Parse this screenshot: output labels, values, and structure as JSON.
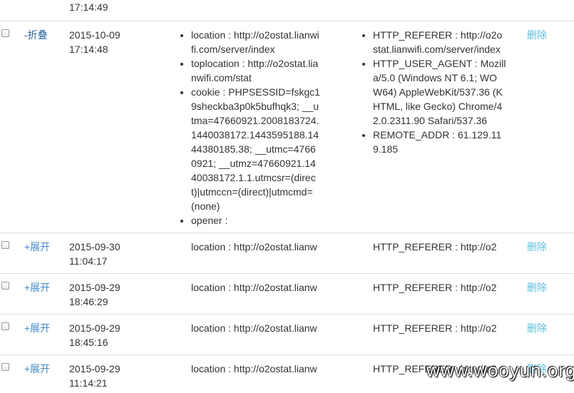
{
  "top_partial": {
    "time": "17:14:49"
  },
  "expanded_row": {
    "toggle": "-折叠",
    "date": "2015-10-09",
    "time": "17:14:48",
    "cookies": [
      "location : http://o2ostat.lianwifi.com/server/index",
      "toplocation : http://o2ostat.lianwifi.com/stat",
      "cookie : PHPSESSID=fskgc19sheckba3p0k5bufhqk3; __utma=47660921.2008183724.1440038172.1443595188.1444380185.38; __utmc=47660921; __utmz=47660921.1440038172.1.1.utmcsr=(direct)|utmccn=(direct)|utmcmd=(none)",
      "opener :"
    ],
    "headers": [
      "HTTP_REFERER : http://o2ostat.lianwifi.com/server/index",
      "HTTP_USER_AGENT : Mozilla/5.0 (Windows NT 6.1; WOW64) AppleWebKit/537.36 (KHTML, like Gecko) Chrome/42.0.2311.90 Safari/537.36",
      "REMOTE_ADDR : 61.129.119.185"
    ],
    "delete": "删除"
  },
  "collapsed_rows": [
    {
      "toggle": "+展开",
      "date": "2015-09-30",
      "time": "11:04:17",
      "location": "location : http://o2ostat.lianw",
      "referer": "HTTP_REFERER : http://o2",
      "delete": "删除"
    },
    {
      "toggle": "+展开",
      "date": "2015-09-29",
      "time": "18:46:29",
      "location": "location : http://o2ostat.lianw",
      "referer": "HTTP_REFERER : http://o2",
      "delete": "删除"
    },
    {
      "toggle": "+展开",
      "date": "2015-09-29",
      "time": "18:45:16",
      "location": "location : http://o2ostat.lianw",
      "referer": "HTTP_REFERER : http://o2",
      "delete": "删除"
    },
    {
      "toggle": "+展开",
      "date": "2015-09-29",
      "time": "11:14:21",
      "location": "location : http://o2ostat.lianw",
      "referer": "HTTP_REFERER : http://o2",
      "delete": "删除"
    }
  ],
  "watermark": "www.wooyun.org"
}
